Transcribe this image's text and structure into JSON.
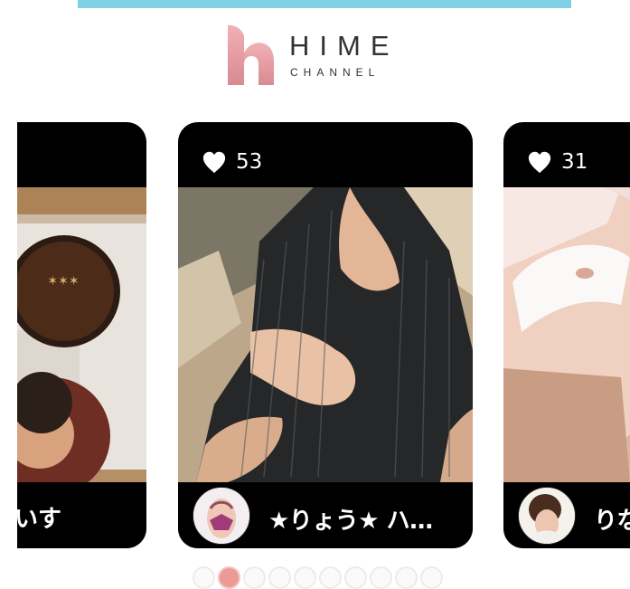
{
  "header": {
    "title": "HIME",
    "subtitle": "CHANNEL"
  },
  "cards": [
    {
      "likes": "",
      "name": "いす",
      "photo_icon": "photo-icon",
      "avatar_icon": "avatar-icon"
    },
    {
      "likes": "53",
      "name": "★りょう★ ハ…",
      "photo_icon": "photo-icon",
      "avatar_icon": "avatar-icon"
    },
    {
      "likes": "31",
      "name": "りな",
      "photo_icon": "photo-icon",
      "avatar_icon": "avatar-icon"
    }
  ],
  "carousel": {
    "current_page": 2,
    "total_pages": 10
  },
  "colors": {
    "top_bar": "#7fd0e4",
    "logo_accent": "#e79aa2",
    "card_background": "#000000",
    "active_dot": "#eb9a95",
    "star": "#f5c343"
  }
}
